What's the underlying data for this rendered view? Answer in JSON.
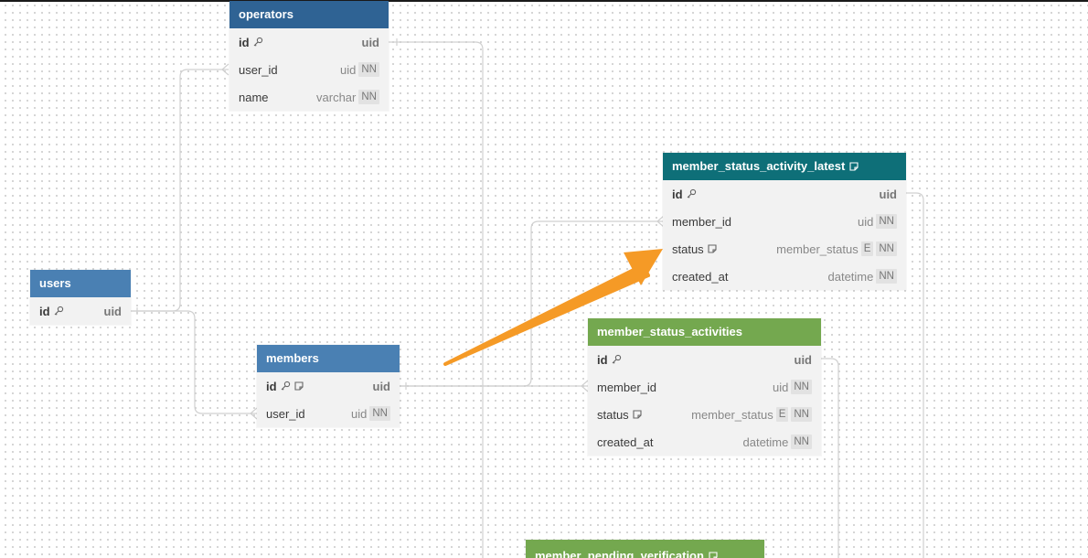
{
  "colors": {
    "blue_dark": "#2f6394",
    "blue": "#4a80b3",
    "teal": "#0e6f78",
    "green": "#74a84f",
    "arrow": "#f59a26",
    "edge": "#d0d0d0"
  },
  "tables": {
    "operators": {
      "name": "operators",
      "fields": [
        {
          "name": "id",
          "type": "uid",
          "pk": true
        },
        {
          "name": "user_id",
          "type": "uid",
          "nn": "NN"
        },
        {
          "name": "name",
          "type": "varchar",
          "nn": "NN"
        }
      ]
    },
    "member_status_activity_latest": {
      "name": "member_status_activity_latest",
      "fields": [
        {
          "name": "id",
          "type": "uid",
          "pk": true
        },
        {
          "name": "member_id",
          "type": "uid",
          "nn": "NN"
        },
        {
          "name": "status",
          "type": "member_status",
          "enum": "E",
          "nn": "NN"
        },
        {
          "name": "created_at",
          "type": "datetime",
          "nn": "NN"
        }
      ]
    },
    "users": {
      "name": "users",
      "fields": [
        {
          "name": "id",
          "type": "uid",
          "pk": true
        }
      ]
    },
    "members": {
      "name": "members",
      "fields": [
        {
          "name": "id",
          "type": "uid",
          "pk": true
        },
        {
          "name": "user_id",
          "type": "uid",
          "nn": "NN"
        }
      ]
    },
    "member_status_activities": {
      "name": "member_status_activities",
      "fields": [
        {
          "name": "id",
          "type": "uid",
          "pk": true
        },
        {
          "name": "member_id",
          "type": "uid",
          "nn": "NN"
        },
        {
          "name": "status",
          "type": "member_status",
          "enum": "E",
          "nn": "NN"
        },
        {
          "name": "created_at",
          "type": "datetime",
          "nn": "NN"
        }
      ]
    },
    "member_pending_verification": {
      "name": "member_pending_verification",
      "fields": []
    }
  }
}
